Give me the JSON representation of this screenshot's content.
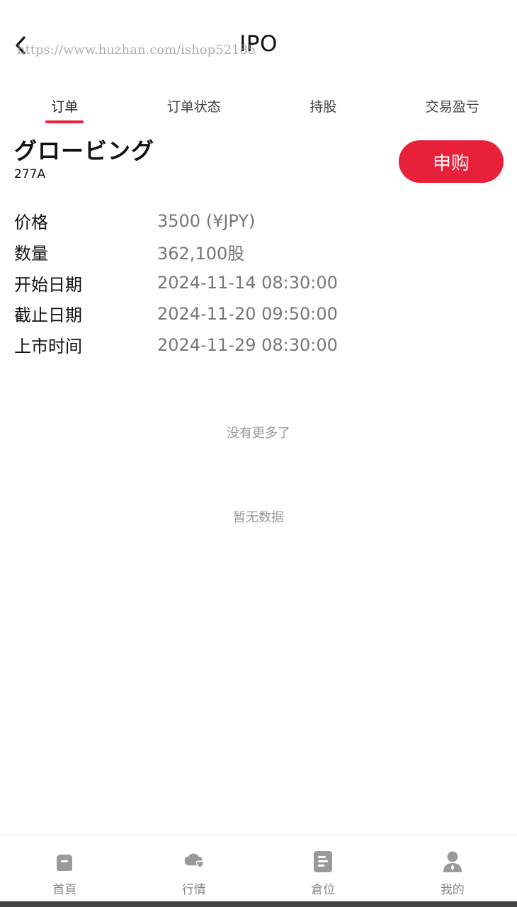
{
  "header": {
    "title": "IPO",
    "watermark": "https://www.huzhan.com/ishop52185"
  },
  "tabs": [
    {
      "label": "订单",
      "active": true
    },
    {
      "label": "订单状态",
      "active": false
    },
    {
      "label": "持股",
      "active": false
    },
    {
      "label": "交易盈亏",
      "active": false
    }
  ],
  "ipo": {
    "name": "グロービング",
    "code": "277A",
    "subscribe_label": "申购",
    "rows": [
      {
        "label": "价格",
        "value": "3500 (¥JPY)"
      },
      {
        "label": "数量",
        "value": "362,100股"
      },
      {
        "label": "开始日期",
        "value": "2024-11-14 08:30:00"
      },
      {
        "label": "截止日期",
        "value": "2024-11-20 09:50:00"
      },
      {
        "label": "上市时间",
        "value": "2024-11-29 08:30:00"
      }
    ]
  },
  "list_status": {
    "no_more": "没有更多了",
    "no_data": "暂无数据"
  },
  "bottom_nav": [
    {
      "label": "首頁",
      "icon": "home-icon"
    },
    {
      "label": "行情",
      "icon": "market-heart-icon"
    },
    {
      "label": "倉位",
      "icon": "position-document-icon"
    },
    {
      "label": "我的",
      "icon": "profile-icon"
    }
  ],
  "colors": {
    "accent": "#e8203a",
    "nav_icon": "#9a9a9a"
  }
}
